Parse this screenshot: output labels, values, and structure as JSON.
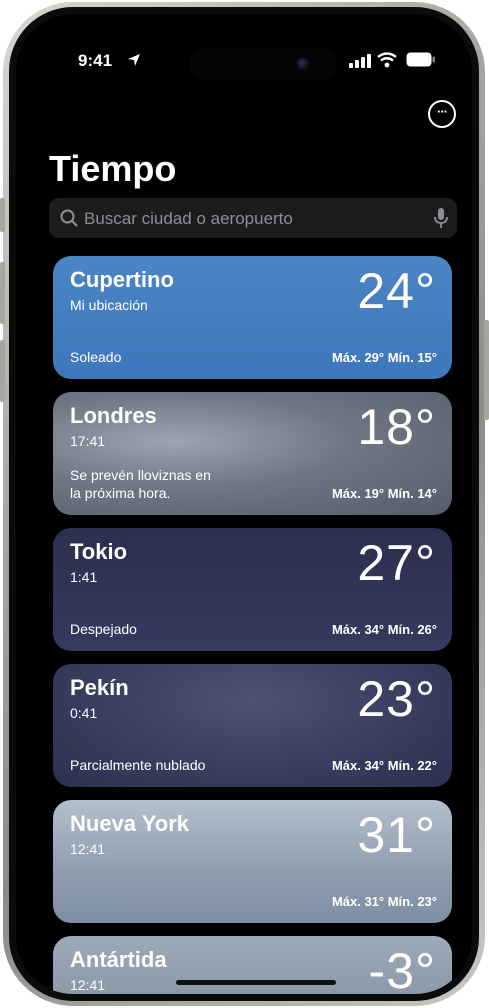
{
  "status_bar": {
    "time": "9:41"
  },
  "header": {
    "more_icon": "ellipsis-circle-icon",
    "title": "Tiempo"
  },
  "search": {
    "placeholder": "Buscar ciudad o aeropuerto",
    "icon": "magnifier-icon",
    "mic_icon": "microphone-icon"
  },
  "cities": [
    {
      "name": "Cupertino",
      "subtitle": "Mi ubicación",
      "temp": "24°",
      "condition": "Soleado",
      "hilo": "Máx. 29° Mín. 15°"
    },
    {
      "name": "Londres",
      "subtitle": "17:41",
      "temp": "18°",
      "condition": "Se prevén lloviznas en la próxima hora.",
      "hilo": "Máx. 19° Mín. 14°"
    },
    {
      "name": "Tokio",
      "subtitle": "1:41",
      "temp": "27°",
      "condition": "Despejado",
      "hilo": "Máx. 34° Mín. 26°"
    },
    {
      "name": "Pekín",
      "subtitle": "0:41",
      "temp": "23°",
      "condition": "Parcialmente nublado",
      "hilo": "Máx. 34° Mín. 22°"
    },
    {
      "name": "Nueva York",
      "subtitle": "12:41",
      "temp": "31°",
      "condition": "",
      "hilo": "Máx. 31° Mín. 23°"
    },
    {
      "name": "Antártida",
      "subtitle": "12:41",
      "temp": "-3°"
    }
  ],
  "colors": {
    "cupertino": "#4682c4",
    "background": "#000000",
    "search_bg": "#1c1c1e"
  }
}
